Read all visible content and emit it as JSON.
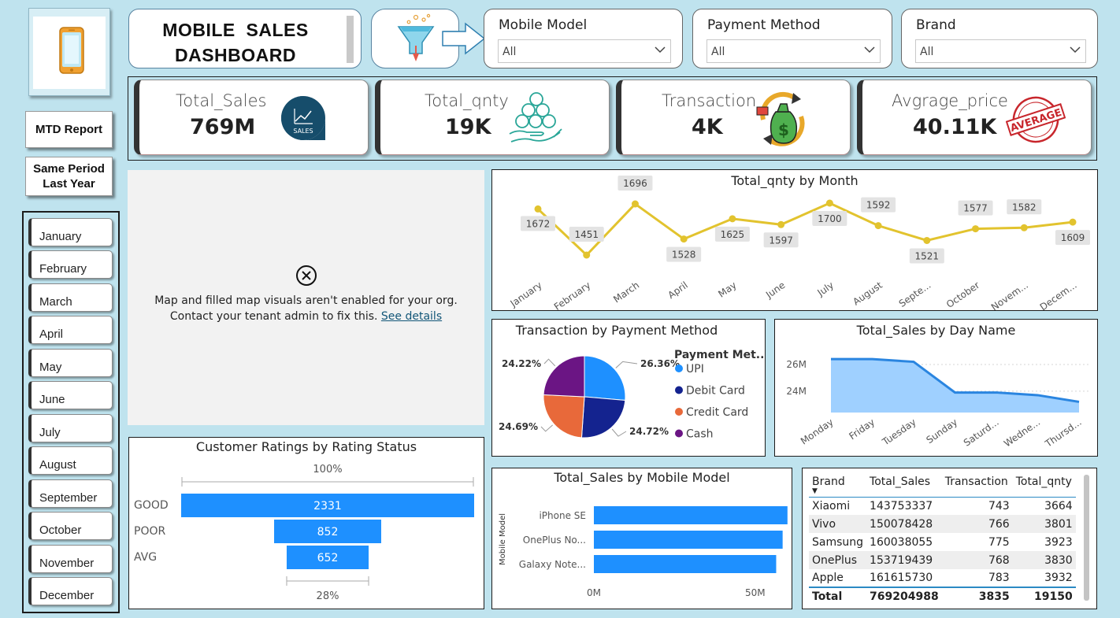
{
  "header": {
    "title_line1": "MOBILE  SALES",
    "title_line2": "DASHBOARD"
  },
  "nav": {
    "mtd_label": "MTD Report",
    "spl_line1": "Same Period",
    "spl_line2": "Last Year"
  },
  "months": [
    "January",
    "February",
    "March",
    "April",
    "May",
    "June",
    "July",
    "August",
    "September",
    "October",
    "November",
    "December"
  ],
  "slicers": [
    {
      "label": "Mobile Model",
      "value": "All"
    },
    {
      "label": "Payment Method",
      "value": "All"
    },
    {
      "label": "Brand",
      "value": "All"
    }
  ],
  "kpis": [
    {
      "title": "Total_Sales",
      "value": "769M",
      "icon": "sales-chart-icon",
      "icon_text": "SALES"
    },
    {
      "title": "Total_qnty",
      "value": "19K",
      "icon": "coins-hand-icon"
    },
    {
      "title": "Transaction",
      "value": "4K",
      "icon": "money-bag-cycle-icon"
    },
    {
      "title": "Avgrage_price",
      "value": "40.11K",
      "icon": "average-stamp-icon",
      "icon_text": "AVERAGE"
    }
  ],
  "map": {
    "message_line1": "Map and filled map visuals aren't enabled for your org.",
    "message_line2": "Contact your tenant admin to fix this.",
    "link_text": "See details"
  },
  "colors": {
    "background": "#bfe3ee",
    "line_gold": "#e2c32e",
    "bar_blue": "#1e90ff",
    "area_fill": "#9fd0ff",
    "area_line": "#2a85e0",
    "pie_upi": "#1e90ff",
    "pie_debit": "#14238f",
    "pie_credit": "#e8693a",
    "pie_cash": "#6b1584"
  },
  "chart_data": [
    {
      "id": "qnty_by_month",
      "type": "line",
      "title": "Total_qnty by Month",
      "categories": [
        "January",
        "February",
        "March",
        "April",
        "May",
        "June",
        "July",
        "August",
        "Septe...",
        "October",
        "Novem...",
        "Decem..."
      ],
      "values": [
        1672,
        1451,
        1696,
        1528,
        1625,
        1597,
        1700,
        1592,
        1521,
        1577,
        1582,
        1609
      ]
    },
    {
      "id": "transaction_by_payment",
      "type": "pie",
      "title": "Transaction by Payment Method",
      "legend_title": "Payment Met...",
      "labels": [
        "UPI",
        "Debit Card",
        "Credit Card",
        "Cash"
      ],
      "values": [
        26.36,
        24.72,
        24.69,
        24.22
      ],
      "value_labels": [
        "26.36%",
        "24.72%",
        "24.69%",
        "24.22%"
      ]
    },
    {
      "id": "sales_by_day",
      "type": "area",
      "title": "Total_Sales by Day Name",
      "categories": [
        "Monday",
        "Friday",
        "Tuesday",
        "Sunday",
        "Saturd...",
        "Wedne...",
        "Thursd..."
      ],
      "values": [
        26.4,
        26.4,
        26.2,
        23.9,
        23.9,
        23.7,
        23.2
      ],
      "yticks": [
        "26M",
        "24M"
      ],
      "ytick_values": [
        26,
        24
      ],
      "ylim": [
        22.4,
        27
      ]
    },
    {
      "id": "ratings_by_status",
      "type": "bar",
      "title": "Customer Ratings by Rating Status",
      "categories": [
        "GOOD",
        "POOR",
        "AVG"
      ],
      "values": [
        2331,
        852,
        652
      ],
      "top_label": "100%",
      "bottom_label": "28%"
    },
    {
      "id": "sales_by_model",
      "type": "bar",
      "title": "Total_Sales by Mobile Model",
      "ylabel": "Mobile Model",
      "categories": [
        "iPhone SE",
        "OnePlus No...",
        "Galaxy Note..."
      ],
      "values": [
        60,
        58.5,
        56.5
      ],
      "xticks": [
        "0M",
        "50M"
      ],
      "xtick_values": [
        0,
        50
      ],
      "xlim": [
        0,
        62
      ]
    },
    {
      "id": "brand_table",
      "type": "table",
      "columns": [
        "Brand",
        "Total_Sales",
        "Transaction",
        "Total_qnty"
      ],
      "rows": [
        [
          "Xiaomi",
          "143753337",
          "743",
          "3664"
        ],
        [
          "Vivo",
          "150078428",
          "766",
          "3801"
        ],
        [
          "Samsung",
          "160038055",
          "775",
          "3923"
        ],
        [
          "OnePlus",
          "153719439",
          "768",
          "3830"
        ],
        [
          "Apple",
          "161615730",
          "783",
          "3932"
        ]
      ],
      "total": [
        "Total",
        "769204988",
        "3835",
        "19150"
      ]
    }
  ]
}
